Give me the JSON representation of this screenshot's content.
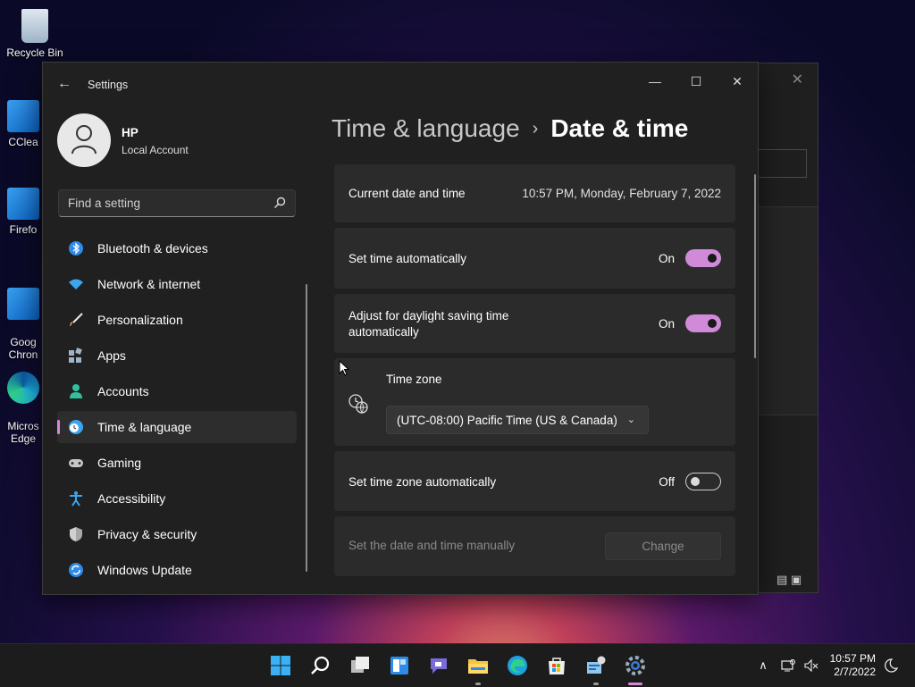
{
  "desktop": {
    "icons": [
      {
        "label": "Recycle Bin"
      },
      {
        "label": "CClea"
      },
      {
        "label": "Firefo"
      },
      {
        "label": "Goog\nChron"
      },
      {
        "label": "Micros\nEdge"
      }
    ]
  },
  "window": {
    "title": "Settings",
    "controls": {
      "minimize": "—",
      "maximize": "☐",
      "close": "✕"
    }
  },
  "profile": {
    "name": "HP",
    "account_type": "Local Account"
  },
  "search": {
    "placeholder": "Find a setting"
  },
  "nav": {
    "items": [
      {
        "label": "Bluetooth & devices",
        "icon": "bluetooth-icon"
      },
      {
        "label": "Network & internet",
        "icon": "wifi-icon"
      },
      {
        "label": "Personalization",
        "icon": "brush-icon"
      },
      {
        "label": "Apps",
        "icon": "apps-icon"
      },
      {
        "label": "Accounts",
        "icon": "person-icon"
      },
      {
        "label": "Time & language",
        "icon": "globe-clock-icon",
        "active": true
      },
      {
        "label": "Gaming",
        "icon": "gamepad-icon"
      },
      {
        "label": "Accessibility",
        "icon": "accessibility-icon"
      },
      {
        "label": "Privacy & security",
        "icon": "shield-icon"
      },
      {
        "label": "Windows Update",
        "icon": "update-icon"
      }
    ]
  },
  "breadcrumb": {
    "parent": "Time & language",
    "separator": "›",
    "current": "Date & time"
  },
  "date_time": {
    "current_label": "Current date and time",
    "current_value": "10:57 PM, Monday, February 7, 2022",
    "set_auto_label": "Set time automatically",
    "set_auto_state": "On",
    "dst_label_line1": "Adjust for daylight saving time",
    "dst_label_line2": "automatically",
    "dst_state": "On",
    "timezone_label": "Time zone",
    "timezone_value": "(UTC-08:00) Pacific Time (US & Canada)",
    "tz_auto_label": "Set time zone automatically",
    "tz_auto_state": "Off",
    "manual_label": "Set the date and time manually",
    "manual_button": "Change"
  },
  "colors": {
    "accent": "#d08ad8",
    "window_bg": "#202020",
    "card_bg": "#2b2b2b"
  },
  "taskbar": {
    "apps": [
      "start-icon",
      "search-icon",
      "task-view-icon",
      "widgets-icon",
      "chat-icon",
      "file-explorer-icon",
      "edge-icon",
      "store-icon",
      "control-panel-icon",
      "settings-icon"
    ],
    "clock_time": "10:57 PM",
    "clock_date": "2/7/2022"
  }
}
